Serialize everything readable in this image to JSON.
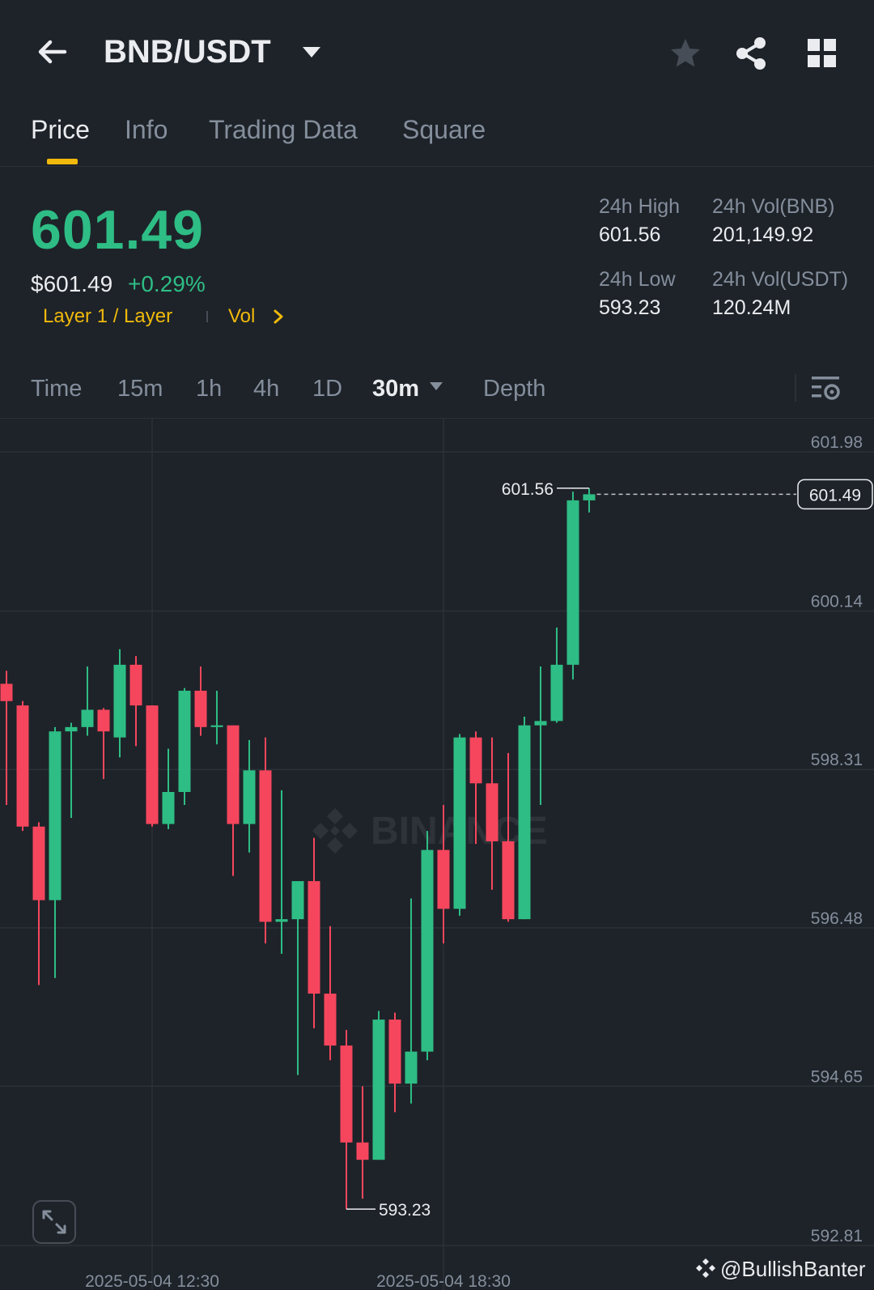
{
  "header": {
    "pair": "BNB/USDT",
    "icons": [
      "back-arrow-icon",
      "caret-down-icon",
      "star-icon",
      "share-icon",
      "grid-icon"
    ]
  },
  "tabs": [
    {
      "label": "Price",
      "active": true
    },
    {
      "label": "Info"
    },
    {
      "label": "Trading Data"
    },
    {
      "label": "Square"
    }
  ],
  "ticker": {
    "last_price": "601.49",
    "usd_price": "$601.49",
    "change_pct": "+0.29%",
    "category": "Layer 1 / Layer",
    "vol_link": "Vol",
    "high_label": "24h High",
    "high_value": "601.56",
    "low_label": "24h Low",
    "low_value": "593.23",
    "vol_base_label": "24h Vol(BNB)",
    "vol_base_value": "201,149.92",
    "vol_quote_label": "24h Vol(USDT)",
    "vol_quote_value": "120.24M"
  },
  "intervals": {
    "items": [
      "Time",
      "15m",
      "1h",
      "4h",
      "1D",
      "30m",
      "Depth"
    ],
    "active": "30m"
  },
  "colors": {
    "up": "#2ebd85",
    "down": "#f6465d",
    "accent": "#f0b90b",
    "background": "#1e2329"
  },
  "chart_data": {
    "type": "candlestick",
    "y_ticks": [
      "601.98",
      "600.14",
      "598.31",
      "596.48",
      "594.65",
      "592.81"
    ],
    "ylim": [
      592.81,
      601.98
    ],
    "x_ticks": [
      "2025-05-04 12:30",
      "2025-05-04 18:30"
    ],
    "current_price_label": "601.49",
    "high_marker": "601.56",
    "low_marker": "593.23",
    "watermark": "BINANCE",
    "candles": [
      {
        "o": 599.3,
        "h": 599.45,
        "l": 597.9,
        "c": 599.1
      },
      {
        "o": 599.05,
        "h": 599.1,
        "l": 597.6,
        "c": 597.65
      },
      {
        "o": 597.65,
        "h": 597.7,
        "l": 595.82,
        "c": 596.8
      },
      {
        "o": 596.8,
        "h": 598.8,
        "l": 595.9,
        "c": 598.75
      },
      {
        "o": 598.75,
        "h": 598.85,
        "l": 597.75,
        "c": 598.8
      },
      {
        "o": 598.8,
        "h": 599.5,
        "l": 598.7,
        "c": 599.0
      },
      {
        "o": 599.0,
        "h": 599.02,
        "l": 598.2,
        "c": 598.75
      },
      {
        "o": 598.68,
        "h": 599.7,
        "l": 598.45,
        "c": 599.52
      },
      {
        "o": 599.52,
        "h": 599.62,
        "l": 598.58,
        "c": 599.05
      },
      {
        "o": 599.05,
        "h": 599.05,
        "l": 597.65,
        "c": 597.68
      },
      {
        "o": 597.68,
        "h": 598.55,
        "l": 597.62,
        "c": 598.05
      },
      {
        "o": 598.05,
        "h": 599.25,
        "l": 597.9,
        "c": 599.22
      },
      {
        "o": 599.22,
        "h": 599.5,
        "l": 598.7,
        "c": 598.8
      },
      {
        "o": 598.8,
        "h": 599.22,
        "l": 598.6,
        "c": 598.82
      },
      {
        "o": 598.82,
        "h": 598.8,
        "l": 597.08,
        "c": 597.68
      },
      {
        "o": 597.68,
        "h": 598.65,
        "l": 597.35,
        "c": 598.3
      },
      {
        "o": 598.3,
        "h": 598.68,
        "l": 596.3,
        "c": 596.55
      },
      {
        "o": 596.55,
        "h": 598.07,
        "l": 596.18,
        "c": 596.58
      },
      {
        "o": 596.58,
        "h": 596.85,
        "l": 594.78,
        "c": 597.02
      },
      {
        "o": 597.02,
        "h": 597.52,
        "l": 595.32,
        "c": 595.72
      },
      {
        "o": 595.72,
        "h": 596.5,
        "l": 594.95,
        "c": 595.12
      },
      {
        "o": 595.12,
        "h": 595.3,
        "l": 593.23,
        "c": 594.0
      },
      {
        "o": 594.0,
        "h": 594.65,
        "l": 593.35,
        "c": 593.8
      },
      {
        "o": 593.8,
        "h": 595.52,
        "l": 593.8,
        "c": 595.42
      },
      {
        "o": 595.42,
        "h": 595.5,
        "l": 594.35,
        "c": 594.68
      },
      {
        "o": 594.68,
        "h": 596.82,
        "l": 594.45,
        "c": 595.05
      },
      {
        "o": 595.05,
        "h": 597.6,
        "l": 594.95,
        "c": 597.38
      },
      {
        "o": 597.38,
        "h": 597.9,
        "l": 596.3,
        "c": 596.7
      },
      {
        "o": 596.7,
        "h": 598.72,
        "l": 596.62,
        "c": 598.68
      },
      {
        "o": 598.68,
        "h": 598.75,
        "l": 597.45,
        "c": 598.15
      },
      {
        "o": 598.15,
        "h": 598.68,
        "l": 596.92,
        "c": 597.48
      },
      {
        "o": 597.48,
        "h": 598.5,
        "l": 596.55,
        "c": 596.58
      },
      {
        "o": 596.58,
        "h": 598.92,
        "l": 596.58,
        "c": 598.82
      },
      {
        "o": 598.82,
        "h": 599.5,
        "l": 597.9,
        "c": 598.87
      },
      {
        "o": 598.87,
        "h": 599.95,
        "l": 598.85,
        "c": 599.52
      },
      {
        "o": 599.52,
        "h": 601.52,
        "l": 599.35,
        "c": 601.42
      },
      {
        "o": 601.42,
        "h": 601.56,
        "l": 601.28,
        "c": 601.49
      }
    ]
  },
  "watermark_handle": "@BullishBanter"
}
